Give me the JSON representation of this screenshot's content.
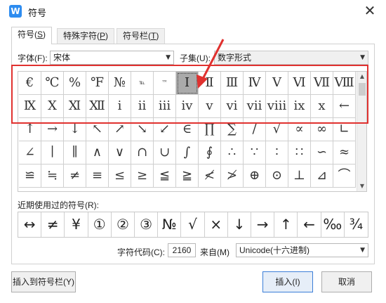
{
  "window": {
    "title": "符号",
    "app_icon_letter": "W",
    "close_glyph": "✕"
  },
  "tabs": [
    {
      "label": "符号(",
      "key": "S",
      "suffix": ")"
    },
    {
      "label": "特殊字符(",
      "key": "P",
      "suffix": ")"
    },
    {
      "label": "符号栏(",
      "key": "T",
      "suffix": ")"
    }
  ],
  "font": {
    "label": "字体(F):",
    "value": "宋体"
  },
  "subset": {
    "label": "子集(U):",
    "value": "数字形式"
  },
  "symbols": [
    "€",
    "℃",
    "%",
    "℉",
    "№",
    "℡",
    "™",
    "Ⅰ",
    "Ⅱ",
    "Ⅲ",
    "Ⅳ",
    "Ⅴ",
    "Ⅵ",
    "Ⅶ",
    "Ⅷ",
    "",
    "Ⅸ",
    "Ⅹ",
    "Ⅺ",
    "Ⅻ",
    "ⅰ",
    "ⅱ",
    "ⅲ",
    "ⅳ",
    "ⅴ",
    "ⅵ",
    "ⅶ",
    "ⅷ",
    "ⅸ",
    "ⅹ",
    "←",
    "",
    "↑",
    "→",
    "↓",
    "↖",
    "↗",
    "↘",
    "↙",
    "∈",
    "∏",
    "∑",
    "/",
    "√",
    "∝",
    "∞",
    "∟",
    "",
    "∠",
    "∣",
    "∥",
    "∧",
    "∨",
    "∩",
    "∪",
    "∫",
    "∮",
    "∴",
    "∵",
    "∶",
    "∷",
    "∽",
    "≈",
    "",
    "≌",
    "≒",
    "≠",
    "≡",
    "≤",
    "≥",
    "≦",
    "≧",
    "≮",
    "≯",
    "⊕",
    "⊙",
    "⊥",
    "⊿",
    "⌒",
    ""
  ],
  "recent": {
    "label": "近期使用过的符号(R):",
    "symbols": [
      "↔",
      "≠",
      "¥",
      "①",
      "②",
      "③",
      "№",
      "√",
      "×",
      "↓",
      "→",
      "↑",
      "←",
      "‰",
      "¾"
    ]
  },
  "code": {
    "label": "字符代码(C):",
    "value": "2160",
    "from_label": "来自(M)",
    "from_value": "Unicode(十六进制)"
  },
  "buttons": {
    "insert_to_bar": "插入到符号栏(Y)",
    "insert": "插入(I)",
    "cancel": "取消"
  },
  "colors": {
    "highlight_border": "#e0312f",
    "selected_cell": "#aaaaaa",
    "app_icon": "#2d8cf0"
  }
}
